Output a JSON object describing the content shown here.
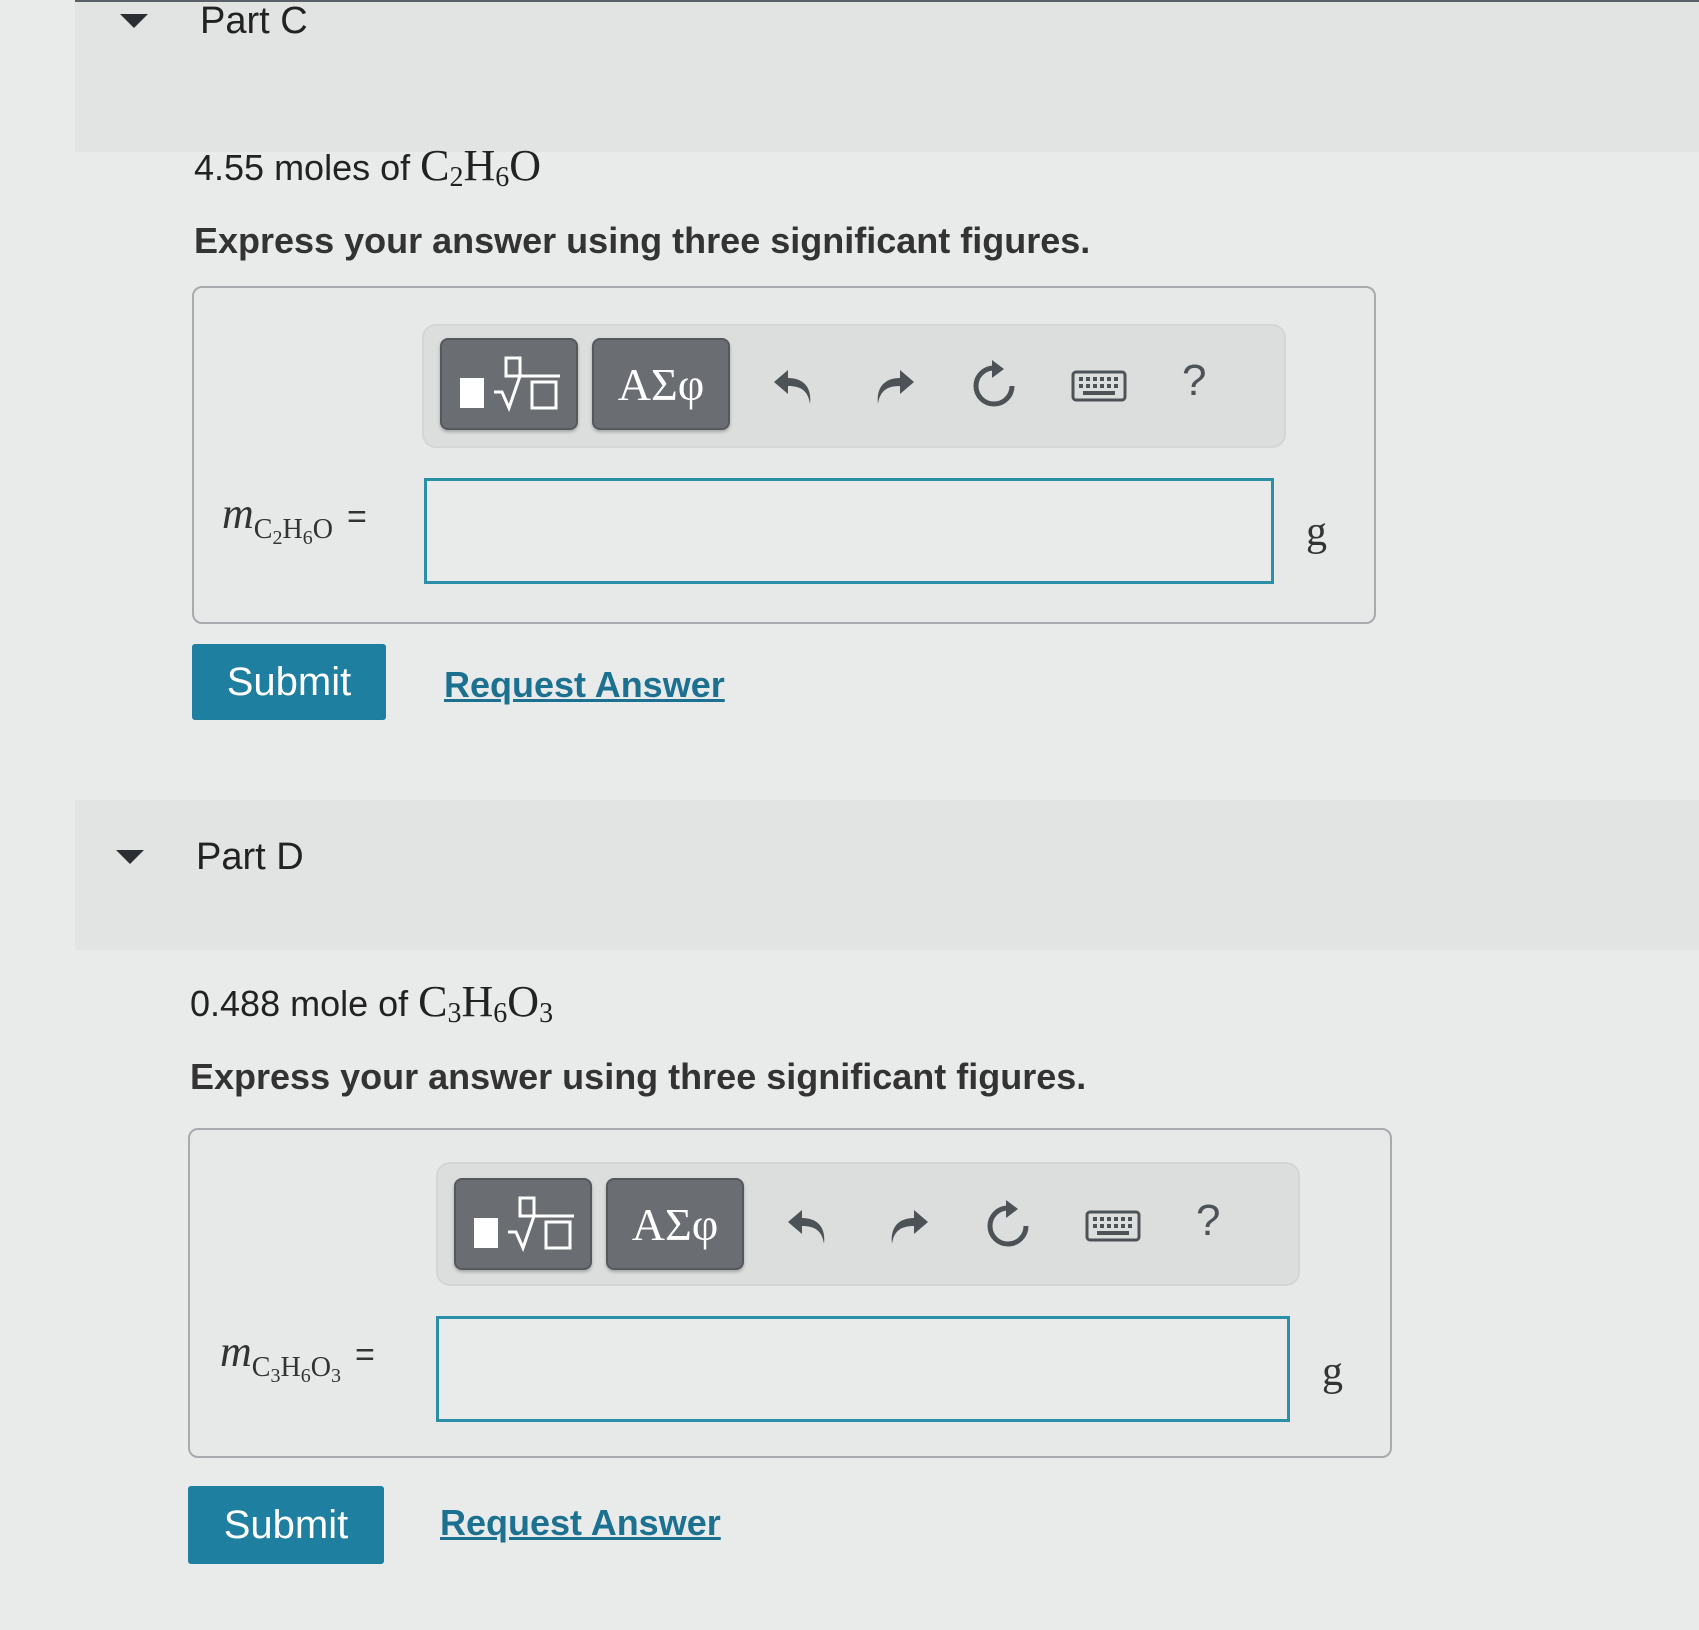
{
  "part_c": {
    "title": "Part C",
    "prompt_text": "4.55 moles of ",
    "instruction": "Express your answer using three significant figures.",
    "toolbar": {
      "greek_label": "ΑΣφ",
      "help_label": "?"
    },
    "input_value": "",
    "unit": "g",
    "submit_label": "Submit",
    "request_label": "Request Answer"
  },
  "part_d": {
    "title": "Part D",
    "prompt_text": "0.488 mole of ",
    "instruction": "Express your answer using three significant figures.",
    "toolbar": {
      "greek_label": "ΑΣφ",
      "help_label": "?"
    },
    "input_value": "",
    "unit": "g",
    "submit_label": "Submit",
    "request_label": "Request Answer"
  },
  "colors": {
    "submit": "#1f7fa0",
    "input_border": "#2b8fa8",
    "link": "#1c7090",
    "toolbar_button": "#6a6e72"
  },
  "icons": [
    "caret-down-icon",
    "templates-icon",
    "undo-icon",
    "redo-icon",
    "reset-icon",
    "keyboard-icon"
  ]
}
